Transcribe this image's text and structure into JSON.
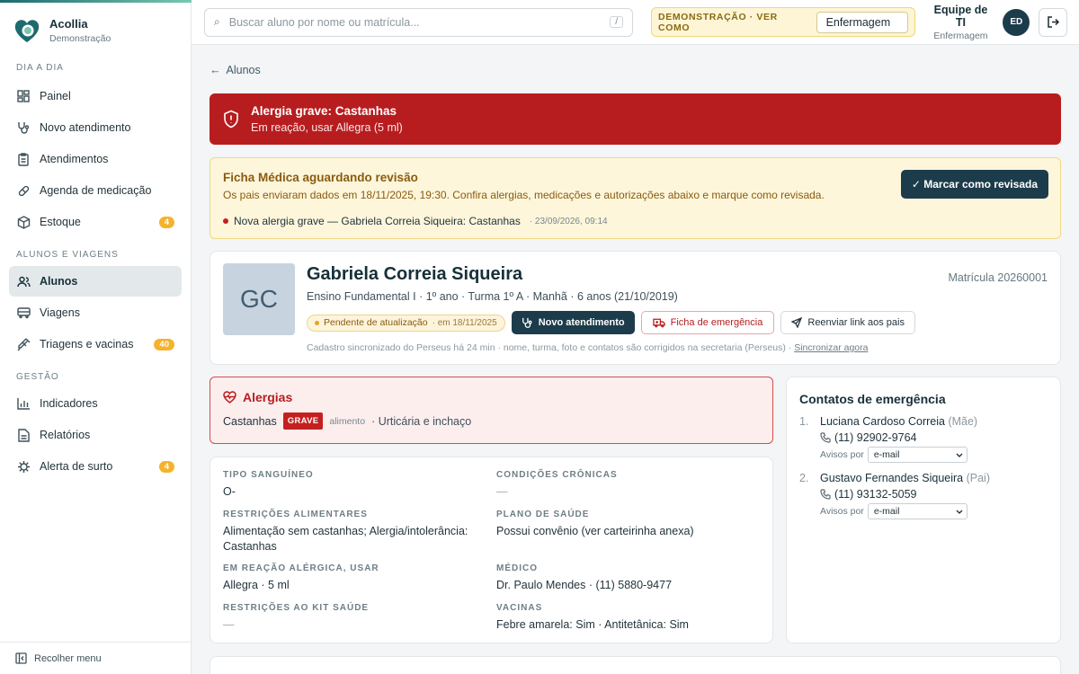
{
  "brand": {
    "name": "Acollia",
    "subtitle": "Demonstração"
  },
  "sidebar": {
    "sections": [
      {
        "label": "DIA A DIA"
      },
      {
        "label": "ALUNOS E VIAGENS"
      },
      {
        "label": "GESTÃO"
      }
    ],
    "items": [
      {
        "label": "Painel",
        "icon": "grid-icon"
      },
      {
        "label": "Novo atendimento",
        "icon": "stethoscope-icon"
      },
      {
        "label": "Atendimentos",
        "icon": "clipboard-icon"
      },
      {
        "label": "Agenda de medicação",
        "icon": "pill-icon"
      },
      {
        "label": "Estoque",
        "icon": "box-icon",
        "badge": "4"
      },
      {
        "label": "Alunos",
        "icon": "users-icon",
        "active": true
      },
      {
        "label": "Viagens",
        "icon": "bus-icon"
      },
      {
        "label": "Triagens e vacinas",
        "icon": "syringe-icon",
        "badge": "40"
      },
      {
        "label": "Indicadores",
        "icon": "bar-chart-icon"
      },
      {
        "label": "Relatórios",
        "icon": "document-icon"
      },
      {
        "label": "Alerta de surto",
        "icon": "virus-icon",
        "badge": "4"
      }
    ],
    "collapse_label": "Recolher menu"
  },
  "topbar": {
    "search_placeholder": "Buscar aluno por nome ou matrícula...",
    "search_shortcut": "/",
    "demo_label": "DEMONSTRAÇÃO · VER COMO",
    "demo_role": "Enfermagem",
    "user_name": "Equipe de TI",
    "user_role": "Enfermagem",
    "avatar_initials": "ED"
  },
  "back_label": "Alunos",
  "alert_severe": {
    "title": "Alergia grave: Castanhas",
    "subtitle": "Em reação, usar Allegra (5 ml)"
  },
  "alert_review": {
    "title": "Ficha Médica aguardando revisão",
    "subtitle": "Os pais enviaram dados em 18/11/2025, 19:30. Confira alergias, medicações e autorizações abaixo e marque como revisada.",
    "event_text": "Nova alergia grave — Gabriela Correia Siqueira: Castanhas",
    "event_time": "· 23/09/2026, 09:14",
    "button_label": "✓ Marcar como revisada"
  },
  "student": {
    "initials": "GC",
    "name": "Gabriela Correia Siqueira",
    "info": "Ensino Fundamental I · 1º ano · Turma 1º A · Manhã · 6 anos (21/10/2019)",
    "matricula": "Matrícula 20260001",
    "pending_label": "Pendente de atualização",
    "pending_date": "· em 18/11/2025",
    "btn_new": "Novo atendimento",
    "btn_emergency": "Ficha de emergência",
    "btn_resend": "Reenviar link aos pais",
    "sync_note": "Cadastro sincronizado do Perseus há 24 min · nome, turma, foto e contatos são corrigidos na secretaria (Perseus) ·",
    "sync_link": "Sincronizar agora"
  },
  "allergies": {
    "title": "Alergias",
    "item": "Castanhas",
    "severity": "GRAVE",
    "type": "alimento",
    "reaction": "· Urticária e inchaço"
  },
  "info": {
    "blood_label": "TIPO SANGUÍNEO",
    "blood_value": "O-",
    "chronic_label": "CONDIÇÕES CRÔNICAS",
    "chronic_value": "—",
    "diet_label": "RESTRIÇÕES ALIMENTARES",
    "diet_value": "Alimentação sem castanhas; Alergia/intolerância: Castanhas",
    "plan_label": "PLANO DE SAÚDE",
    "plan_value": "Possui convênio (ver carteirinha anexa)",
    "reaction_label": "EM REAÇÃO ALÉRGICA, USAR",
    "reaction_value": "Allegra · 5 ml",
    "doctor_label": "MÉDICO",
    "doctor_value": "Dr. Paulo Mendes · (11) 5880-9477",
    "kit_label": "RESTRIÇÕES AO KIT SAÚDE",
    "kit_value": "—",
    "vaccine_label": "VACINAS",
    "vaccine_value": "Febre amarela: Sim · Antitetânica: Sim"
  },
  "contacts": {
    "title": "Contatos de emergência",
    "notify_label": "Avisos por",
    "list": [
      {
        "num": "1.",
        "name": "Luciana Cardoso Correia",
        "relation": "(Mãe)",
        "phone": "(11) 92902-9764",
        "channel": "e-mail"
      },
      {
        "num": "2.",
        "name": "Gustavo Fernandes Siqueira",
        "relation": "(Pai)",
        "phone": "(11) 93132-5059",
        "channel": "e-mail"
      }
    ]
  },
  "colors": {
    "brand_dark": "#1c3c4b",
    "alert_red": "#b71d1f",
    "warning_bg": "#fdf6db",
    "badge": "#f5b22c"
  }
}
